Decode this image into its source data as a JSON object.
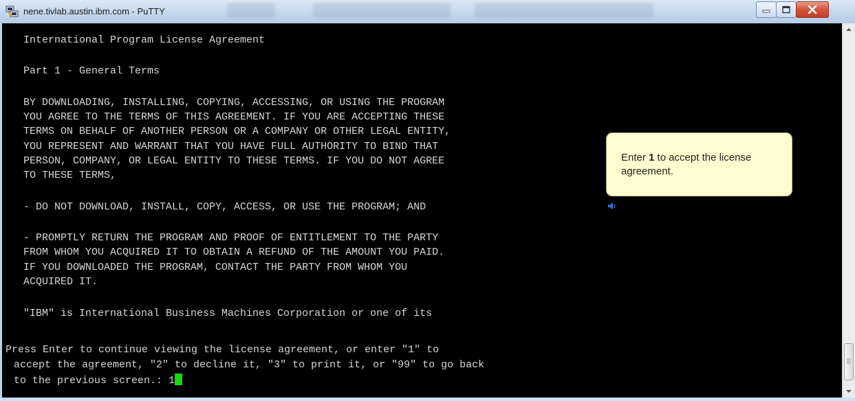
{
  "window": {
    "title": "nene.tivlab.austin.ibm.com - PuTTY"
  },
  "terminal": {
    "lines": [
      "International Program License Agreement",
      "Part 1 - General Terms",
      "BY DOWNLOADING, INSTALLING, COPYING, ACCESSING, OR USING THE PROGRAM",
      "YOU AGREE TO THE TERMS OF THIS AGREEMENT. IF YOU ARE ACCEPTING THESE",
      "TERMS ON BEHALF OF ANOTHER PERSON OR A COMPANY OR OTHER LEGAL ENTITY,",
      "YOU REPRESENT AND WARRANT THAT YOU HAVE FULL AUTHORITY TO BIND THAT",
      "PERSON, COMPANY, OR LEGAL ENTITY TO THESE TERMS. IF YOU DO NOT AGREE",
      "TO THESE TERMS,",
      "- DO NOT DOWNLOAD, INSTALL, COPY, ACCESS, OR USE THE PROGRAM; AND",
      "- PROMPTLY RETURN THE PROGRAM AND PROOF OF ENTITLEMENT TO THE PARTY",
      "FROM WHOM YOU ACQUIRED IT TO OBTAIN A REFUND OF THE AMOUNT YOU PAID.",
      "IF YOU DOWNLOADED THE PROGRAM, CONTACT THE PARTY FROM WHOM YOU",
      "ACQUIRED IT.",
      "\"IBM\" is International Business Machines Corporation or one of its",
      "Press Enter to continue viewing the license agreement, or enter \"1\" to",
      "accept the agreement, \"2\" to decline it, \"3\" to print it, or \"99\" to go back",
      "to the previous screen.: 1"
    ]
  },
  "callout": {
    "prefix": "Enter ",
    "key": "1",
    "suffix": " to accept the license agreement."
  },
  "icons": {
    "app": "putty-icon",
    "minimize": "minimize-icon",
    "maximize": "maximize-icon",
    "close": "close-icon",
    "speaker": "speaker-icon"
  },
  "colors": {
    "terminal_bg": "#000000",
    "terminal_fg": "#d6d6d6",
    "cursor": "#16d616",
    "callout_bg": "#fefdd0",
    "close_button": "#d4553c"
  }
}
